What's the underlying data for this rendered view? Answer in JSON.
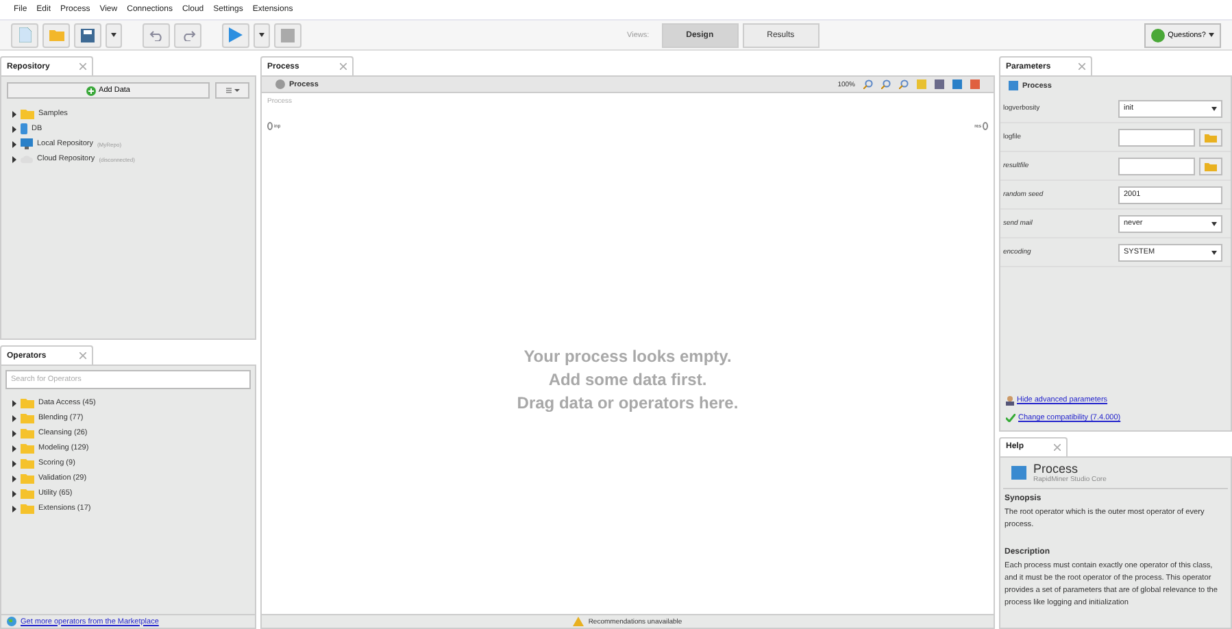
{
  "menu": [
    "File",
    "Edit",
    "Process",
    "View",
    "Connections",
    "Cloud",
    "Settings",
    "Extensions"
  ],
  "toolbar": {
    "views_label": "Views:",
    "views": [
      {
        "label": "Design",
        "selected": true
      },
      {
        "label": "Results",
        "selected": false
      }
    ],
    "help": "Questions?"
  },
  "repository": {
    "tab": "Repository",
    "add_button": "Add Data",
    "items": [
      {
        "label": "Samples",
        "kind": "folder"
      },
      {
        "label": "DB",
        "kind": "db"
      },
      {
        "label": "Local Repository",
        "note": "(MyRepo)",
        "kind": "local"
      },
      {
        "label": "Cloud Repository",
        "note": "(disconnected)",
        "kind": "cloud"
      }
    ]
  },
  "operators": {
    "tab": "Operators",
    "search": {
      "placeholder": "Search for Operators"
    },
    "items": [
      {
        "label": "Data Access (45)"
      },
      {
        "label": "Blending (77)"
      },
      {
        "label": "Cleansing (26)"
      },
      {
        "label": "Modeling (129)"
      },
      {
        "label": "Scoring (9)"
      },
      {
        "label": "Validation (29)"
      },
      {
        "label": "Utility (65)"
      },
      {
        "label": "Extensions (17)"
      }
    ],
    "marketplace_link": "Get more operators from the Marketplace"
  },
  "process": {
    "tab": "Process",
    "breadcrumb": "Process",
    "zoom": "100%",
    "canvas_title": "Process",
    "input_port": "inp",
    "output_port": "res",
    "empty_lines": [
      "Your process looks empty.",
      "Add some data first.",
      "Drag data or operators here."
    ],
    "status": "Recommendations unavailable"
  },
  "parameters": {
    "tab": "Parameters",
    "operator": "Process",
    "rows": [
      {
        "name": "logverbosity",
        "kind": "select",
        "value": "init",
        "italic": false
      },
      {
        "name": "logfile",
        "kind": "file",
        "value": "",
        "italic": false
      },
      {
        "name": "resultfile",
        "kind": "file",
        "value": "",
        "italic": true
      },
      {
        "name": "random seed",
        "kind": "text",
        "value": "2001",
        "italic": true
      },
      {
        "name": "send mail",
        "kind": "select",
        "value": "never",
        "italic": true
      },
      {
        "name": "encoding",
        "kind": "select",
        "value": "SYSTEM",
        "italic": true
      }
    ],
    "links": [
      "Hide advanced parameters",
      "Change compatibility (7.4.000)"
    ]
  },
  "help": {
    "tab": "Help",
    "title": "Process",
    "subtitle": "RapidMiner Studio Core",
    "sections": [
      {
        "heading": "Synopsis",
        "text": "The root operator which is the outer most operator of every process."
      },
      {
        "heading": "Description",
        "text": "Each process must contain exactly one operator of this class, and it must be the root operator of the process. This operator provides a set of parameters that are of global relevance to the process like logging and initialization"
      }
    ]
  }
}
